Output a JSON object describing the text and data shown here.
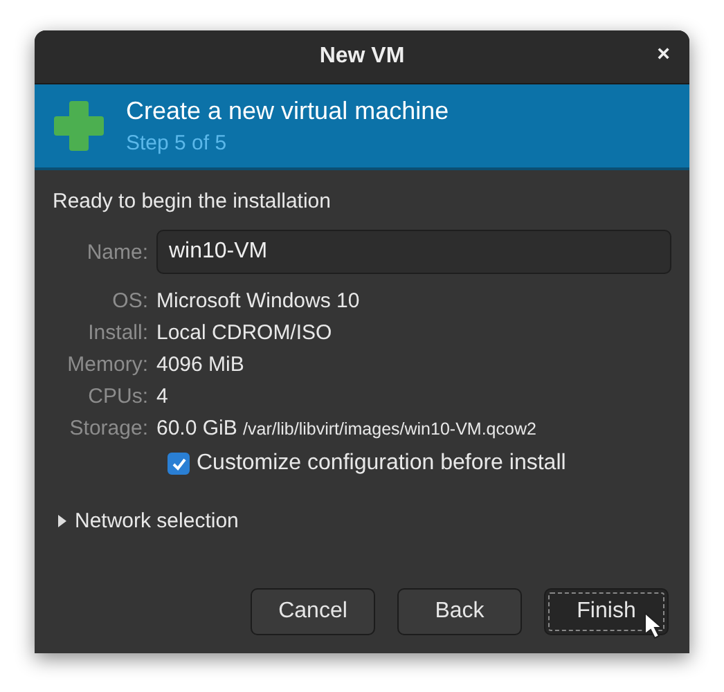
{
  "window": {
    "title": "New VM",
    "close": "×"
  },
  "banner": {
    "title": "Create a new virtual machine",
    "subtitle": "Step 5 of 5"
  },
  "heading": "Ready to begin the installation",
  "details": [
    {
      "kind": "field",
      "label": "Name:",
      "value": "win10-VM"
    },
    {
      "kind": "text",
      "label": "OS:",
      "value": "Microsoft Windows 10"
    },
    {
      "kind": "text",
      "label": "Install:",
      "value": "Local CDROM/ISO"
    },
    {
      "kind": "text",
      "label": "Memory:",
      "value": "4096 MiB"
    },
    {
      "kind": "text",
      "label": "CPUs:",
      "value": "4"
    },
    {
      "kind": "storage",
      "label": "Storage:",
      "value": "60.0 GiB",
      "path": "/var/lib/libvirt/images/win10-VM.qcow2"
    }
  ],
  "customize": {
    "label": "Customize configuration before install",
    "checked": true
  },
  "network": {
    "label": "Network selection",
    "expanded": false
  },
  "buttons": [
    {
      "label": "Cancel",
      "focused": false
    },
    {
      "label": "Back",
      "focused": false
    },
    {
      "label": "Finish",
      "focused": true
    }
  ]
}
